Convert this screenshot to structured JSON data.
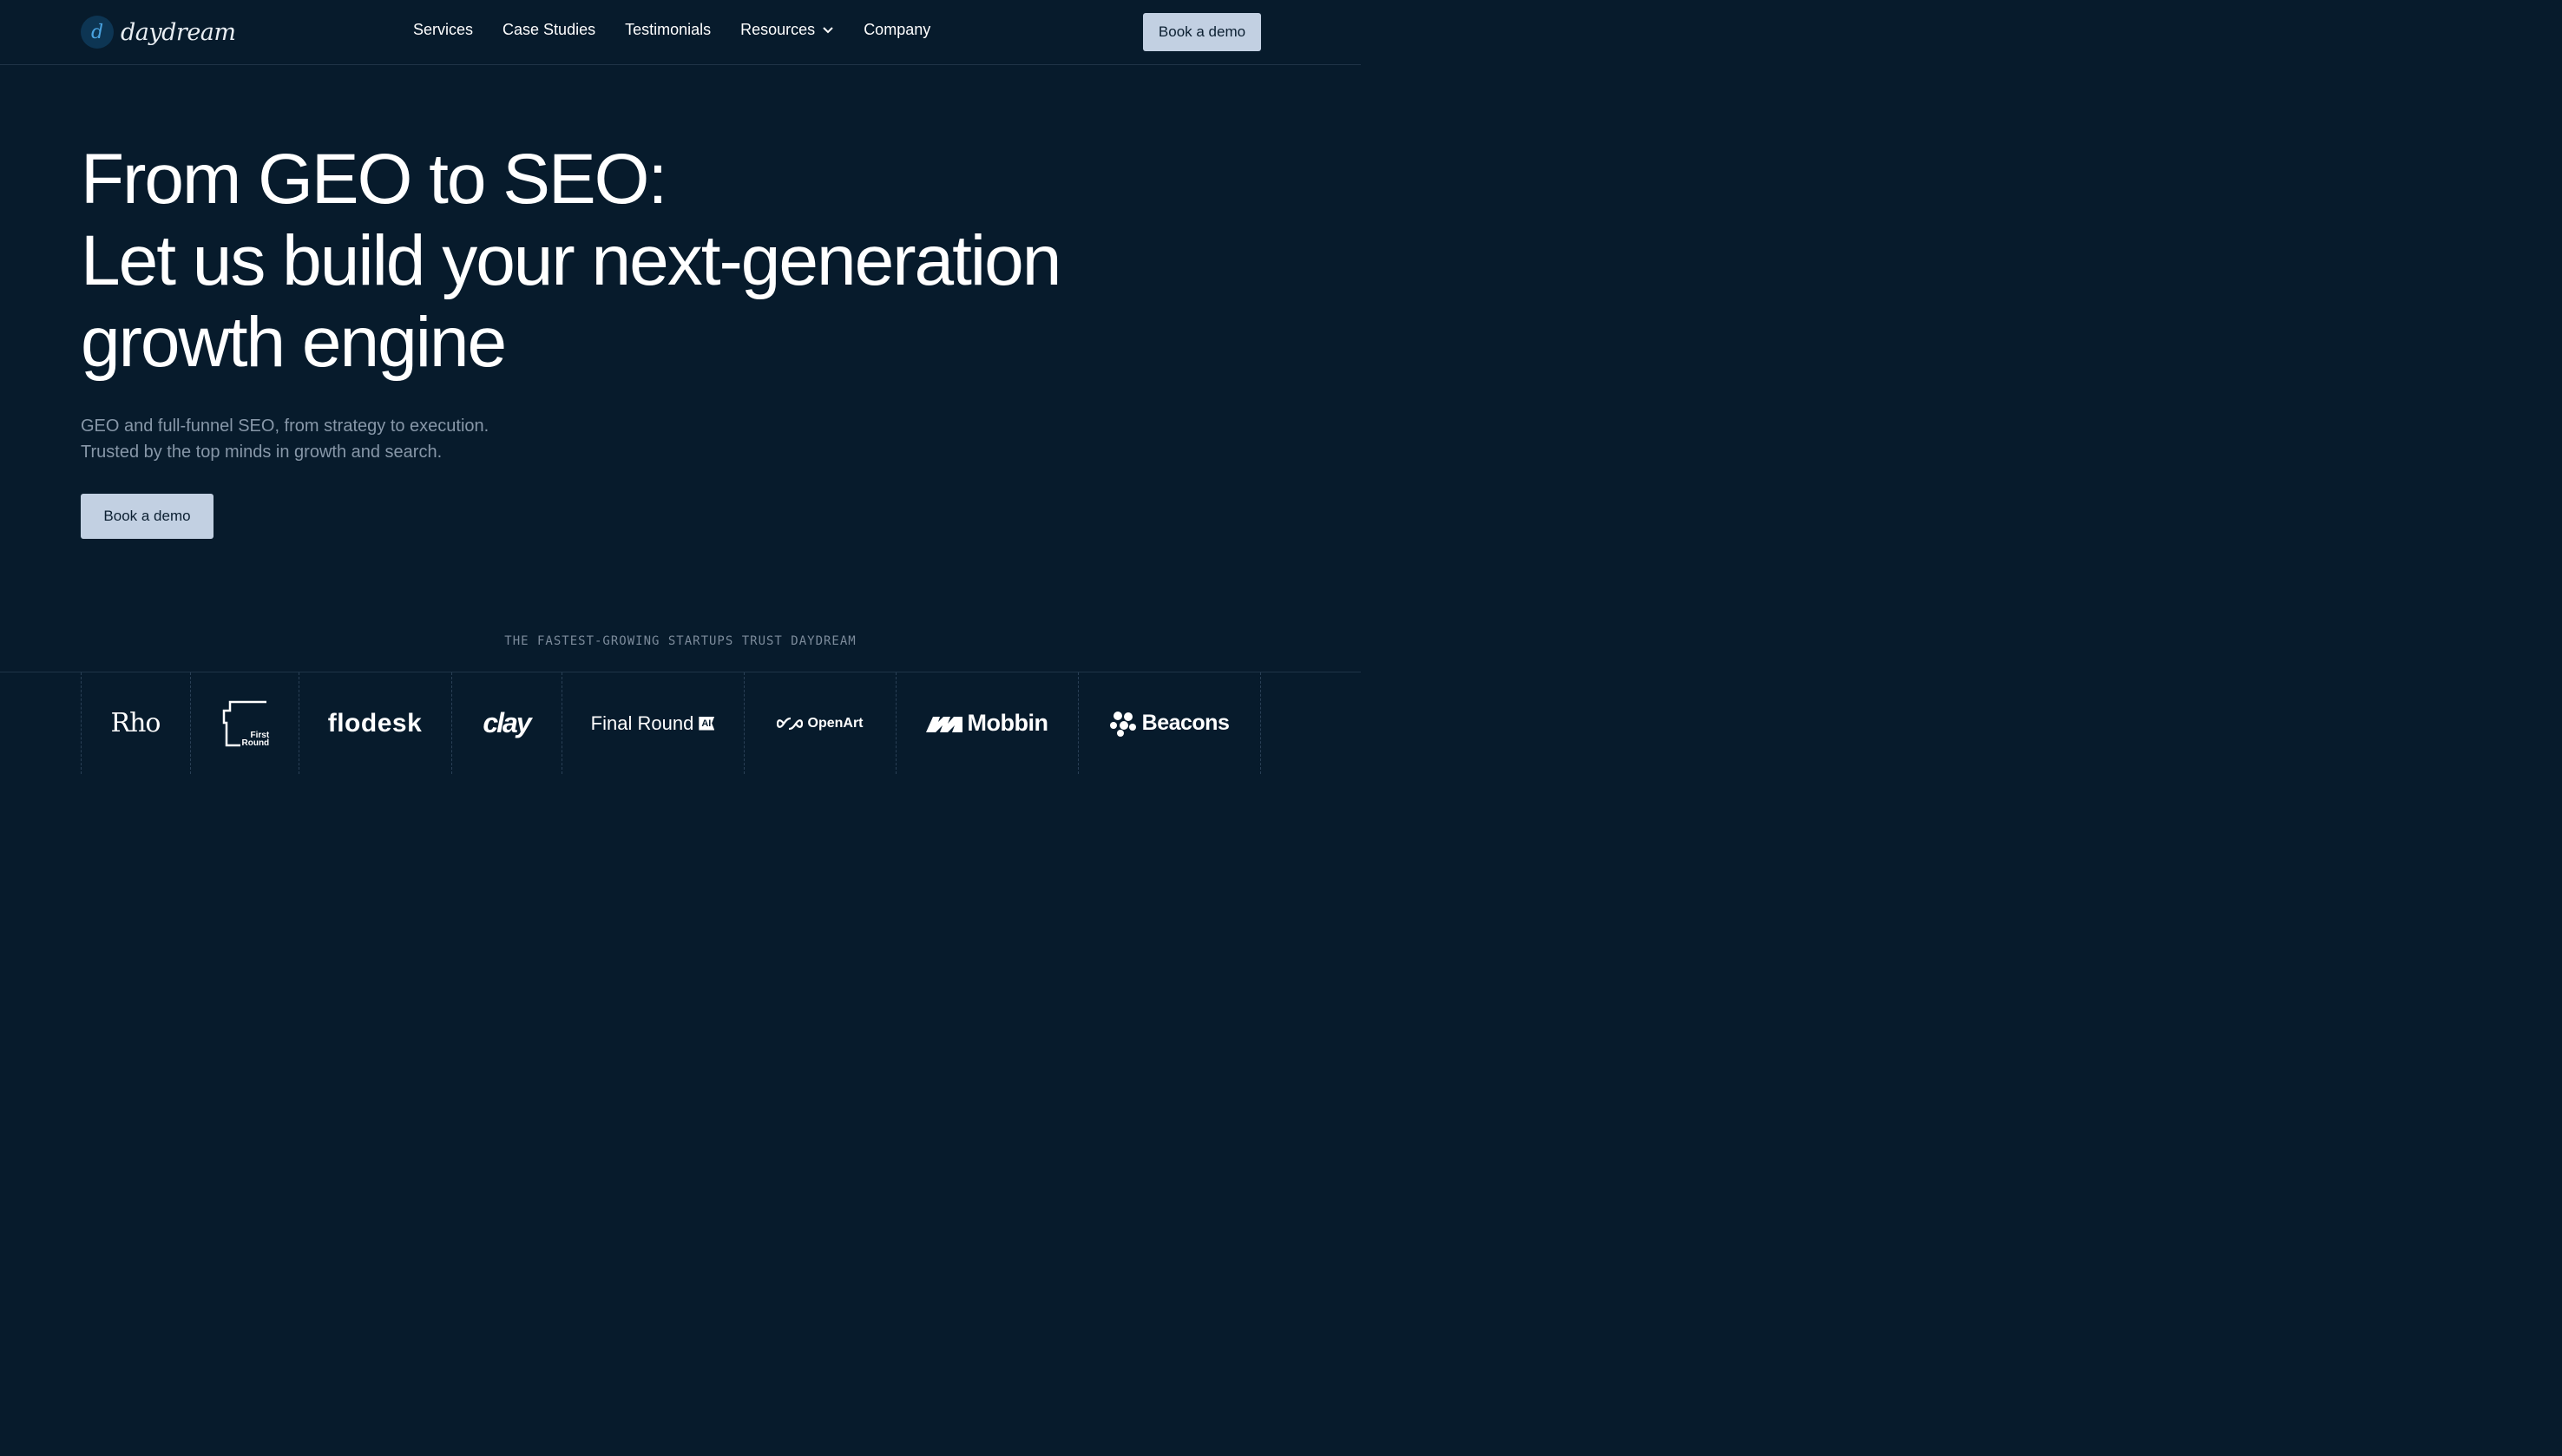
{
  "brand": {
    "logo_letter": "d",
    "name": "daydream"
  },
  "nav": {
    "items": [
      {
        "label": "Services"
      },
      {
        "label": "Case Studies"
      },
      {
        "label": "Testimonials"
      },
      {
        "label": "Resources",
        "has_dropdown": true
      },
      {
        "label": "Company"
      }
    ],
    "cta_label": "Book a demo"
  },
  "hero": {
    "title_lines": [
      "From GEO to SEO:",
      "Let us build your next-generation",
      "growth engine"
    ],
    "subtitle_lines": [
      "GEO and full-funnel SEO, from strategy to execution.",
      "Trusted by the top minds in growth and search."
    ],
    "cta_label": "Book a demo"
  },
  "trust": {
    "label": "THE FASTEST-GROWING STARTUPS TRUST DAYDREAM",
    "logos": [
      {
        "name": "Rho"
      },
      {
        "name": "First Round",
        "line1": "First",
        "line2": "Round"
      },
      {
        "name": "flodesk"
      },
      {
        "name": "clay"
      },
      {
        "name": "Final Round",
        "badge": "AI"
      },
      {
        "name": "OpenArt"
      },
      {
        "name": "Mobbin"
      },
      {
        "name": "Beacons"
      }
    ]
  },
  "colors": {
    "background": "#071b2c",
    "button": "#c2d0e2",
    "button_text": "#0b1f31",
    "subtitle": "#8797a8",
    "logo_accent": "#4aa3e0"
  }
}
